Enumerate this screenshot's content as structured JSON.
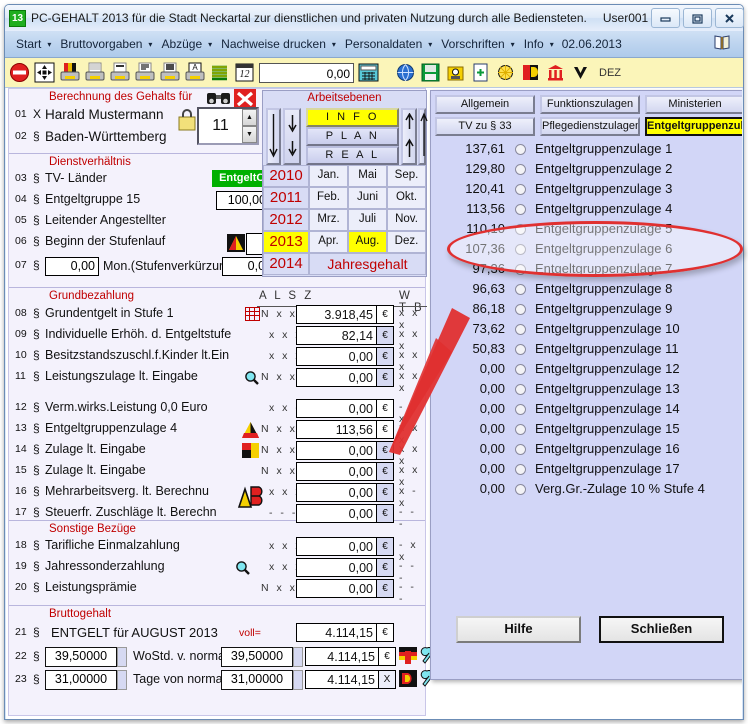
{
  "window": {
    "app_icon_label": "13",
    "title": "PC-GEHALT 2013 für die Stadt Neckartal zur dienstlichen und privaten Nutzung durch alle Bediensteten.",
    "user": "User001",
    "buttons": {
      "minimize": "minimize-icon",
      "maximize": "maximize-icon",
      "close": "close-icon"
    }
  },
  "menubar": {
    "items": [
      {
        "label": "Start",
        "has_caret": true
      },
      {
        "label": "Bruttovorgaben",
        "has_caret": true
      },
      {
        "label": "Abzüge",
        "has_caret": true
      },
      {
        "label": "Nachweise drucken",
        "has_caret": true
      },
      {
        "label": "Personaldaten",
        "has_caret": true
      },
      {
        "label": "Vorschriften",
        "has_caret": true
      },
      {
        "label": "Info",
        "has_caret": true
      }
    ],
    "date": "02.06.2013",
    "help_icon": "book-icon"
  },
  "toolbar": {
    "icons": [
      "stop-icon",
      "move-arrows-icon",
      "print-color-icon",
      "print-plain-icon",
      "print-draft-icon",
      "print-list-icon",
      "print-text-icon",
      "print-letter-icon",
      "stack-icon",
      "calendar-12-icon"
    ],
    "value": "0,00",
    "calc_icon": "calculator-icon",
    "right_icons": [
      "globe-icon",
      "save-green-icon",
      "person-yellow-icon",
      "doc-add-icon",
      "sun-icon",
      "flag-d-icon",
      "bank-icon",
      "v-icon"
    ],
    "dez_label": "DEZ"
  },
  "left_panel": {
    "header": {
      "title": "Berechnung des Gehalts für",
      "binoculars_icon": "binoculars-icon",
      "close_icon": "red-x-icon",
      "lock_icon": "lock-icon",
      "spinner_value": "11"
    },
    "person_rows": [
      {
        "num": "01",
        "mark": "X",
        "label": "Harald Mustermann"
      },
      {
        "num": "02",
        "mark": "§",
        "label": "Baden-Württemberg"
      }
    ],
    "sections": [
      {
        "title": "Dienstverhältnis",
        "rows": [
          {
            "num": "03",
            "mark": "§",
            "label": "TV- Länder",
            "badge": "EntgeltO"
          },
          {
            "num": "04",
            "mark": "§",
            "label": "Entgeltgruppe 15",
            "value": "100,00"
          },
          {
            "num": "05",
            "mark": "§",
            "label": "Leitender Angestellter"
          },
          {
            "num": "06",
            "mark": "§",
            "label": "Beginn der Stufenlauf",
            "icon": "warn-triangle-icon",
            "value": ""
          },
          {
            "num": "07",
            "mark": "§",
            "label": "Mon.(Stufenverkürzur",
            "value_left": "0,00",
            "value_right": "0,00"
          }
        ]
      },
      {
        "title": "Grundbezahlung",
        "col_headers_left": "A L S Z",
        "col_headers_right": "W T B",
        "rows": [
          {
            "num": "08",
            "mark": "§",
            "label": "Grundentgelt in Stufe 1",
            "icon": "table-icon",
            "flags": "N x x x",
            "amount": "3.918,45",
            "currency": "€",
            "wtb": "x x x"
          },
          {
            "num": "09",
            "mark": "§",
            "label": "Individuelle Erhöh. d. Entgeltstufe",
            "flags": "x x x",
            "amount": "82,14",
            "currency": "€",
            "wtb": "x x x"
          },
          {
            "num": "10",
            "mark": "§",
            "label": "Besitzstandszuschl.f.Kinder lt.Ein",
            "flags": "x x x",
            "amount": "0,00",
            "currency": "€",
            "wtb": "x x x"
          },
          {
            "num": "11",
            "mark": "§",
            "label": "Leistungszulage lt. Eingabe",
            "icon": "magnifier-icon",
            "flags": "N x x x",
            "amount": "0,00",
            "currency": "€",
            "wtb": "x x x"
          },
          {
            "num": "12",
            "mark": "§",
            "label": "Verm.wirks.Leistung   0,0 Euro",
            "flags": "x x -",
            "amount": "0,00",
            "currency": "€",
            "wtb": "- x x"
          },
          {
            "num": "13",
            "mark": "§",
            "label": "Entgeltgruppenzulage 4",
            "icon": "warn-triangle-icon",
            "flags": "N x x x",
            "amount": "113,56",
            "currency": "€",
            "wtb": "x x x"
          },
          {
            "num": "14",
            "mark": "§",
            "label": "Zulage lt. Eingabe",
            "icon": "flag-block-icon",
            "flags": "N x x x",
            "amount": "0,00",
            "currency": "€",
            "wtb": "x x x"
          },
          {
            "num": "15",
            "mark": "§",
            "label": "Zulage lt. Eingabe",
            "flags": "N x x x",
            "amount": "0,00",
            "currency": "€",
            "wtb": "x x x"
          },
          {
            "num": "16",
            "mark": "§",
            "label": "Mehrarbeitsverg. lt. Berechnu",
            "icon": "ab-icon",
            "flags": "x x x",
            "amount": "0,00",
            "currency": "€",
            "wtb": "x - x"
          },
          {
            "num": "17",
            "mark": "§",
            "label": "Steuerfr. Zuschläge lt. Berechn",
            "icon": "ab-icon",
            "flags": "- - -",
            "amount": "0,00",
            "currency": "€",
            "wtb": "- - -"
          }
        ]
      },
      {
        "title": "Sonstige Bezüge",
        "rows": [
          {
            "num": "18",
            "mark": "§",
            "label": "Tarifliche Einmalzahlung",
            "flags": "x x x",
            "amount": "0,00",
            "currency": "€",
            "wtb": "- x x"
          },
          {
            "num": "19",
            "mark": "§",
            "label": "Jahressonderzahlung",
            "icon": "magnifier-icon",
            "flags": "x x x",
            "amount": "0,00",
            "currency": "€",
            "wtb": "- - -"
          },
          {
            "num": "20",
            "mark": "§",
            "label": "Leistungsprämie",
            "flags": "N x x x",
            "amount": "0,00",
            "currency": "€",
            "wtb": "- - -"
          }
        ]
      },
      {
        "title": "Bruttogehalt",
        "rows": [
          {
            "num": "21",
            "mark": "§",
            "label": "ENTGELT für AUGUST  2013",
            "note": "voll=",
            "amount": "4.114,15",
            "currency": "€"
          },
          {
            "num": "22",
            "mark": "§",
            "input_left": "39,50000",
            "label": "WoStd. v. normal",
            "input_right": "39,50000",
            "amount": "4.114,15",
            "currency": "€",
            "icons": [
              "flag-t-icon",
              "wrench-icon"
            ]
          },
          {
            "num": "23",
            "mark": "§",
            "input_left": "31,00000",
            "label": "Tage von normal",
            "input_right": "31,00000",
            "amount": "4.114,15",
            "currency": "X",
            "icons": [
              "flag-d-icon",
              "wrench-icon"
            ]
          }
        ]
      }
    ]
  },
  "center_panel": {
    "title": "Arbeitsebenen",
    "levels": [
      {
        "label": "I N F O",
        "active": true
      },
      {
        "label": "P L A N",
        "active": false
      },
      {
        "label": "R E A L",
        "active": false
      }
    ],
    "years": [
      {
        "label": "2010",
        "active": false
      },
      {
        "label": "2011",
        "active": false
      },
      {
        "label": "2012",
        "active": false
      },
      {
        "label": "2013",
        "active": true
      },
      {
        "label": "2014",
        "active": false
      }
    ],
    "months": [
      [
        {
          "label": "Jan.",
          "active": false
        },
        {
          "label": "Mai",
          "active": false
        },
        {
          "label": "Sep.",
          "active": false
        }
      ],
      [
        {
          "label": "Feb.",
          "active": false
        },
        {
          "label": "Juni",
          "active": false
        },
        {
          "label": "Okt.",
          "active": false
        }
      ],
      [
        {
          "label": "Mrz.",
          "active": false
        },
        {
          "label": "Juli",
          "active": false
        },
        {
          "label": "Nov.",
          "active": false
        }
      ],
      [
        {
          "label": "Apr.",
          "active": false
        },
        {
          "label": "Aug.",
          "active": true
        },
        {
          "label": "Dez.",
          "active": false
        }
      ]
    ],
    "year_total_label": "Jahresgehalt"
  },
  "right_panel": {
    "tabs_row1": [
      {
        "label": "Allgemein",
        "active": false
      },
      {
        "label": "Funktionszulagen",
        "active": false
      },
      {
        "label": "Ministerien",
        "active": false
      }
    ],
    "tabs_row2": [
      {
        "label": "TV zu § 33",
        "active": false
      },
      {
        "label": "Pflegedienstzulagen",
        "active": false
      },
      {
        "label": "Entgeltgruppenzulagen",
        "active": true
      }
    ],
    "items": [
      {
        "value": "137,61",
        "label": "Entgeltgruppenzulage 1",
        "selected": false
      },
      {
        "value": "129,80",
        "label": "Entgeltgruppenzulage 2",
        "selected": false
      },
      {
        "value": "120,41",
        "label": "Entgeltgruppenzulage 3",
        "selected": false
      },
      {
        "value": "113,56",
        "label": "Entgeltgruppenzulage 4",
        "selected": true
      },
      {
        "value": "110,10",
        "label": "Entgeltgruppenzulage 5",
        "selected": false
      },
      {
        "value": "107,36",
        "label": "Entgeltgruppenzulage 6",
        "selected": false
      },
      {
        "value": "97,36",
        "label": "Entgeltgruppenzulage 7",
        "selected": false
      },
      {
        "value": "96,63",
        "label": "Entgeltgruppenzulage 8",
        "selected": false
      },
      {
        "value": "86,18",
        "label": "Entgeltgruppenzulage 9",
        "selected": false
      },
      {
        "value": "73,62",
        "label": "Entgeltgruppenzulage 10",
        "selected": false
      },
      {
        "value": "50,83",
        "label": "Entgeltgruppenzulage 11",
        "selected": false
      },
      {
        "value": "0,00",
        "label": "Entgeltgruppenzulage 12",
        "selected": false
      },
      {
        "value": "0,00",
        "label": "Entgeltgruppenzulage 13",
        "selected": false
      },
      {
        "value": "0,00",
        "label": "Entgeltgruppenzulage 14",
        "selected": false
      },
      {
        "value": "0,00",
        "label": "Entgeltgruppenzulage 15",
        "selected": false
      },
      {
        "value": "0,00",
        "label": "Entgeltgruppenzulage 16",
        "selected": false
      },
      {
        "value": "0,00",
        "label": "Entgeltgruppenzulage 17",
        "selected": false
      },
      {
        "value": "0,00",
        "label": "Verg.Gr.-Zulage 10 % Stufe 4",
        "selected": false
      }
    ],
    "help_button": "Hilfe",
    "close_button": "Schließen"
  },
  "annotation": {
    "type": "callout-arrow",
    "color": "#e03030",
    "highlight_target": "Entgeltgruppenzulage 4",
    "source_target": "113,56"
  },
  "colors": {
    "title_blue": "#cfe0f4",
    "toolbar_yellow": "#fbf5b9",
    "panel_lilac": "#d2d6f7",
    "form_bg": "#f4f2fc",
    "red_label": "#c00000",
    "highlight_yellow": "#ffff00",
    "green_badge": "#00b000",
    "annotation_red": "#e03030"
  }
}
